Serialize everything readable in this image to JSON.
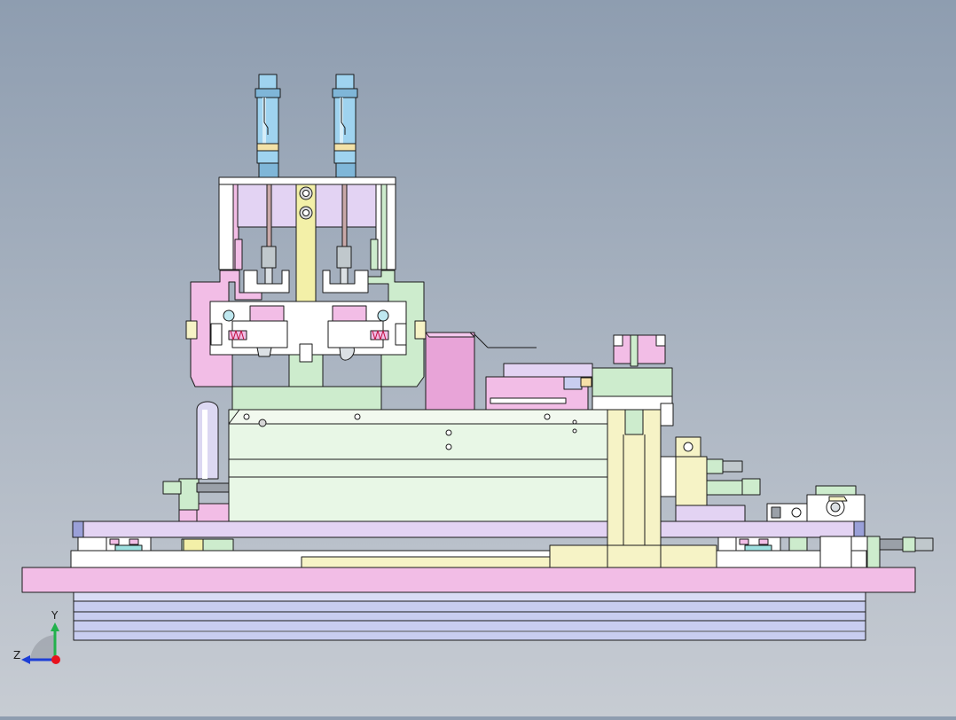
{
  "viewport": {
    "background_top": "#8e9db0",
    "background_bottom": "#c7ccd3"
  },
  "triad": {
    "y_label": "Y",
    "z_label": "Z",
    "y_color": "#22b14c",
    "z_color": "#1d3fd6",
    "x_color": "#e8121d"
  },
  "colors": {
    "pink": "#f2bde6",
    "lavender": "#ddd2f5",
    "light_green": "#cdeccd",
    "mint": "#e8f7e6",
    "cream": "#f6f3c6",
    "yellow": "#f3f0a8",
    "white": "#ffffff",
    "blue_gray": "#c8cdf0",
    "magenta": "#e8a4d8",
    "cylinder_blue": "#9fd3ef",
    "steel": "#9aa0a8",
    "outline": "#1a1a1a"
  }
}
